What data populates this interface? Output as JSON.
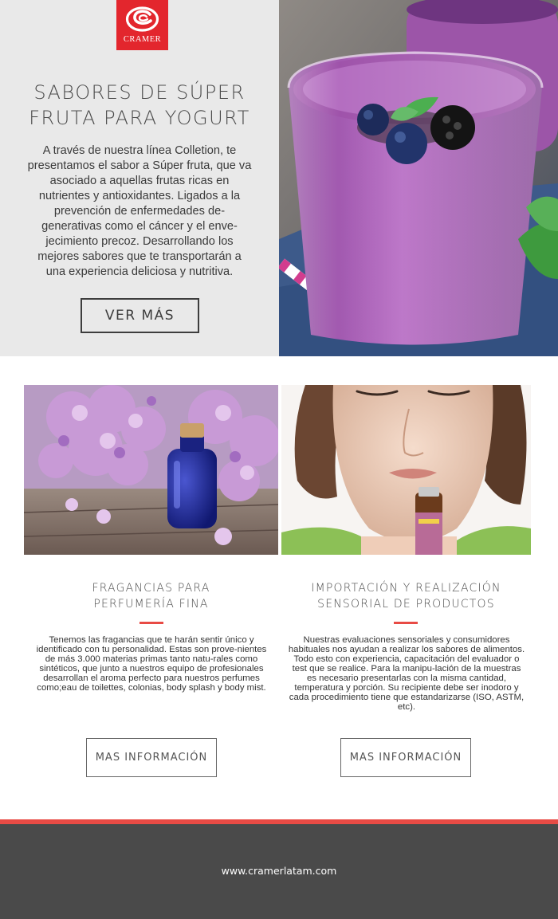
{
  "brand": {
    "name": "CRAMER",
    "color": "#e3262d"
  },
  "hero": {
    "title_line1": "SABORES DE SÚPER",
    "title_line2": "FRUTA PARA YOGURT",
    "body": "A través de nuestra línea Colletion, te presentamos el sabor a Súper fruta, que va asociado a aquellas frutas ricas en nutrientes y antioxidantes. Ligados a la prevención de enfermedades de-generativas como el cáncer y el enve-jecimiento precoz. Desarrollando los mejores sabores que te transportarán a una experiencia deliciosa y nutritiva.",
    "button_label": "VER MÁS",
    "image": "berry-smoothie-photo"
  },
  "cards": [
    {
      "title_line1": "FRAGANCIAS PARA",
      "title_line2": "PERFUMERÍA FINA",
      "body": "Tenemos las fragancias que te harán sentir único y identificado con tu personalidad. Estas son prove-nientes de más 3.000 materias primas tanto natu-rales como sintéticos, que junto a nuestros equipo de profesionales desarrollan el aroma perfecto para nuestros perfumes como;eau de toilettes, colonias, body splash y body mist.",
      "button_label": "MAS INFORMACIÓN",
      "image": "lilac-perfume-bottle-photo"
    },
    {
      "title_line1": "IMPORTACIÓN Y REALIZACIÓN",
      "title_line2": "SENSORIAL DE PRODUCTOS",
      "body": "Nuestras evaluaciones sensoriales y consumidores habituales nos ayudan a realizar los sabores de alimentos. Todo esto con experiencia, capacitación del evaluador o test que se realice. Para la manipu-lación de la muestras es necesario presentarlas con la misma cantidad, temperatura y porción. Su recipiente debe ser inodoro y cada procedimiento tiene que estandarizarse (ISO, ASTM, etc).",
      "button_label": "MAS INFORMACIÓN",
      "image": "woman-smelling-essential-oil-photo"
    }
  ],
  "footer": {
    "link": "www.cramerlatam.com"
  },
  "colors": {
    "accent": "#e84b45",
    "hero_panel": "#e9e9e9",
    "footer_bg": "#4a4a4a"
  }
}
